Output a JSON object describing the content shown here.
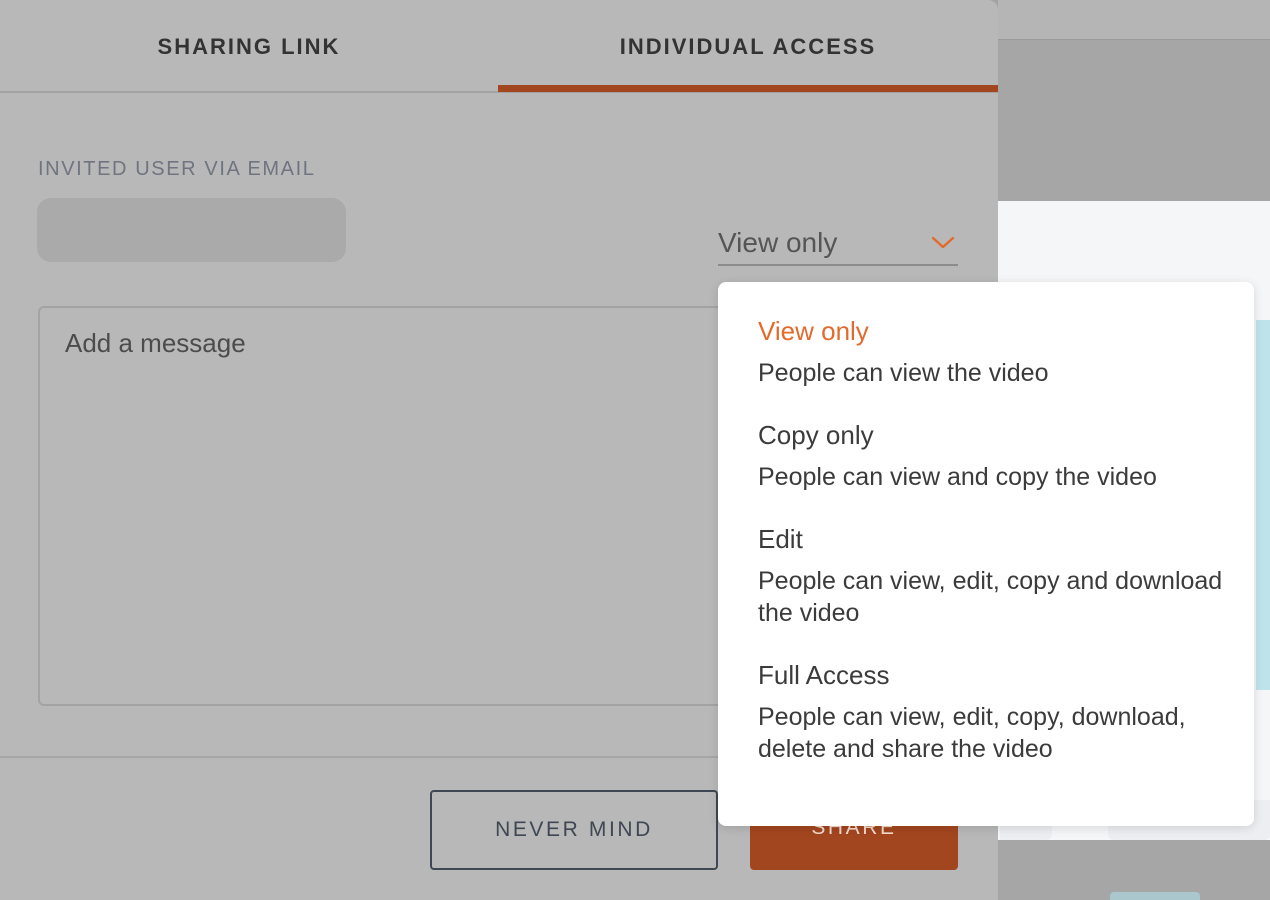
{
  "tabs": [
    {
      "label": "SHARING LINK",
      "active": false
    },
    {
      "label": "INDIVIDUAL ACCESS",
      "active": true
    }
  ],
  "form": {
    "email_label": "INVITED USER VIA EMAIL",
    "email_value": "",
    "message_placeholder": "Add a message"
  },
  "permission": {
    "selected": "View only",
    "options": [
      {
        "title": "View only",
        "description": "People can view the video",
        "selected": true
      },
      {
        "title": "Copy only",
        "description": "People can view and copy the video",
        "selected": false
      },
      {
        "title": "Edit",
        "description": "People can view, edit, copy and download the video",
        "selected": false
      },
      {
        "title": "Full Access",
        "description": "People can view, edit, copy, download, delete and share the video",
        "selected": false
      }
    ]
  },
  "footer": {
    "cancel_label": "NEVER MIND",
    "share_label": "SHARE"
  },
  "colors": {
    "accent": "#e26a2c",
    "share_button_dimmed": "#a2461f",
    "text_dark": "#3b3b3b"
  }
}
